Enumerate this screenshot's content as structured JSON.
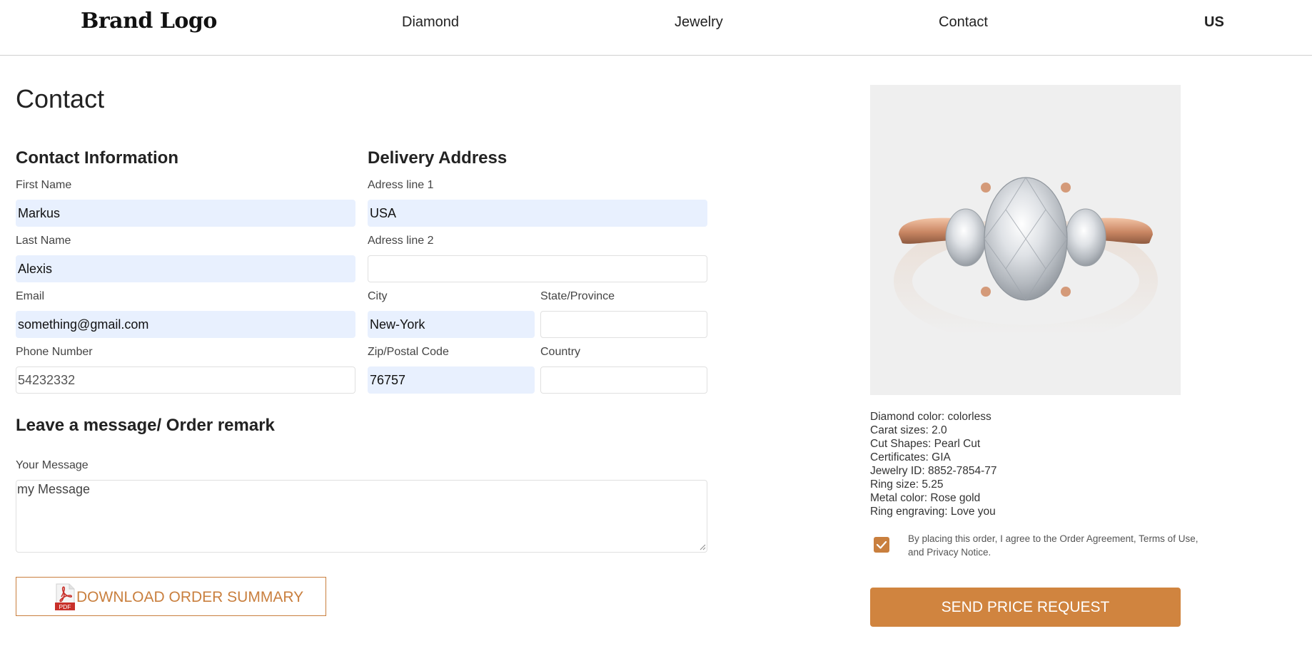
{
  "header": {
    "logo": "Brand Logo",
    "nav": {
      "diamond": "Diamond",
      "jewelry": "Jewelry",
      "contact": "Contact",
      "locale": "US"
    }
  },
  "page_title": "Contact",
  "contact_info": {
    "title": "Contact Information",
    "first_name": {
      "label": "First Name",
      "value": "Markus"
    },
    "last_name": {
      "label": "Last Name",
      "value": "Alexis"
    },
    "email": {
      "label": "Email",
      "value": "something@gmail.com"
    },
    "phone": {
      "label": "Phone Number",
      "value": "54232332"
    }
  },
  "delivery": {
    "title": "Delivery Address",
    "address1": {
      "label": "Adress line 1",
      "value": "USA"
    },
    "address2": {
      "label": "Adress line 2",
      "value": ""
    },
    "city": {
      "label": "City",
      "value": "New-York"
    },
    "state": {
      "label": "State/Province",
      "value": ""
    },
    "zip": {
      "label": "Zip/Postal Code",
      "value": "76757"
    },
    "country": {
      "label": "Country",
      "value": ""
    }
  },
  "message": {
    "title": "Leave a message/ Order remark",
    "label": "Your Message",
    "value": "my Message"
  },
  "download": {
    "label": "DOWNLOAD ORDER SUMMARY",
    "icon": "pdf-icon",
    "icon_text": "PDF"
  },
  "product": {
    "image": "ring-image",
    "specs": [
      "Diamond color: colorless",
      "Carat sizes: 2.0",
      "Cut Shapes: Pearl Cut",
      "Certificates: GIA",
      "Jewelry ID: 8852-7854-77",
      "Ring size: 5.25",
      "Metal color: Rose gold",
      "Ring engraving: Love you"
    ]
  },
  "agreement": {
    "checked": true,
    "text": "By placing this order, I agree to the Order Agreement, Terms of Use, and Privacy Notice."
  },
  "send_button": {
    "label": "SEND PRICE REQUEST"
  },
  "colors": {
    "accent": "#c97f3e",
    "autofill": "#e8f0fe"
  }
}
